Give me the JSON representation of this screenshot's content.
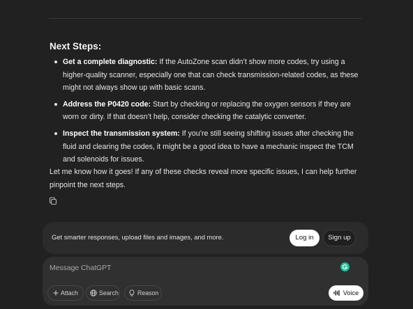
{
  "response": {
    "heading": "Next Steps:",
    "steps": [
      {
        "title": "Get a complete diagnostic:",
        "body": " If the AutoZone scan didn’t show more codes, try using a higher-quality scanner, especially one that can check transmission-related codes, as these might not always show up with basic scans."
      },
      {
        "title": "Address the P0420 code:",
        "body": " Start by checking or replacing the oxygen sensors if they are worn or dirty. If that doesn’t help, consider checking the catalytic converter."
      },
      {
        "title": "Inspect the transmission system:",
        "body": " If you’re still seeing shifting issues after checking the fluid and clearing the codes, it might be a good idea to have a mechanic inspect the TCM and solenoids for issues."
      }
    ],
    "closing": "Let me know how it goes! If any of these checks reveal more specific issues, I can help further pinpoint the next steps.",
    "copy_icon": "copy-icon"
  },
  "banner": {
    "text": "Get smarter responses, upload files and images, and more.",
    "login_label": "Log in",
    "signup_label": "Sign up"
  },
  "composer": {
    "placeholder": "Message ChatGPT",
    "attach_label": "Attach",
    "search_label": "Search",
    "reason_label": "Reason",
    "voice_label": "Voice",
    "extension_color": "#15c39a"
  },
  "colors": {
    "background": "#212121",
    "surface": "#303030",
    "text": "#ececec"
  }
}
